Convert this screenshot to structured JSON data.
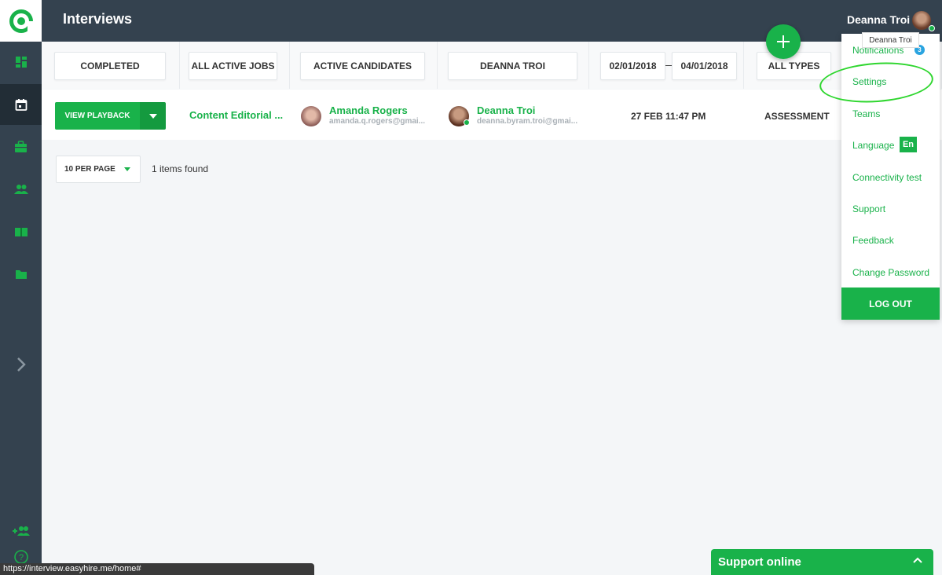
{
  "header": {
    "title": "Interviews",
    "user_name": "Deanna Troi"
  },
  "filters": {
    "status": "COMPLETED",
    "jobs": "ALL ACTIVE JOBS",
    "candidates": "ACTIVE CANDIDATES",
    "interviewer": "DEANNA TROI",
    "date_from": "02/01/2018",
    "date_to": "04/01/2018",
    "types": "ALL TYPES"
  },
  "row": {
    "action": "VIEW PLAYBACK",
    "job": "Content Editorial ...",
    "candidate_name": "Amanda Rogers",
    "candidate_email": "amanda.q.rogers@gmai...",
    "interviewer_name": "Deanna Troi",
    "interviewer_email": "deanna.byram.troi@gmai...",
    "datetime": "27 FEB 11:47 PM",
    "type": "ASSESSMENT"
  },
  "pagination": {
    "per_page": "10 PER PAGE",
    "items_found": "1 items found"
  },
  "menu": {
    "tooltip": "Deanna Troi",
    "notifications": "Notifications",
    "notifications_count": "3",
    "settings": "Settings",
    "teams": "Teams",
    "language": "Language",
    "language_code": "En",
    "connectivity": "Connectivity test",
    "support": "Support",
    "feedback": "Feedback",
    "change_password": "Change Password",
    "logout": "LOG OUT"
  },
  "support_widget": {
    "label": "Support online"
  },
  "status_bar": {
    "url": "https://interview.easyhire.me/home#"
  },
  "colors": {
    "brand_green": "#19b24a",
    "sidebar": "#34424f"
  }
}
